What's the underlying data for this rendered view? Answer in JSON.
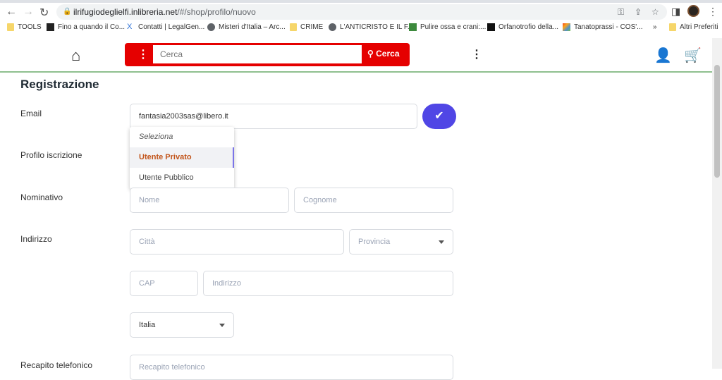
{
  "browser": {
    "url_host": "ilrifugiodeglielfi.inlibreria.net",
    "url_path": "/#/shop/profilo/nuovo",
    "bookmarks": [
      {
        "label": "TOOLS",
        "icon": "folder-icon"
      },
      {
        "label": "Fino a quando il Co...",
        "icon": "site-icon"
      },
      {
        "label": "Contatti | LegalGen...",
        "icon": "dna-icon"
      },
      {
        "label": "Misteri d'Italia – Arc...",
        "icon": "globe-icon"
      },
      {
        "label": "CRIME",
        "icon": "folder-icon"
      },
      {
        "label": "L'ANTICRISTO E IL F...",
        "icon": "globe-icon"
      },
      {
        "label": "Pulire ossa e crani:...",
        "icon": "site-icon"
      },
      {
        "label": "Orfanotrofio della...",
        "icon": "site-icon"
      },
      {
        "label": "Tanatoprassi - COS'...",
        "icon": "joomla-icon"
      }
    ],
    "more": "»",
    "other_bookmarks": "Altri Preferiti"
  },
  "header": {
    "search_placeholder": "Cerca",
    "search_button": "Cerca"
  },
  "form": {
    "title": "Registrazione",
    "email_label": "Email",
    "email_value": "fantasia2003sas@libero.it",
    "profile_label": "Profilo iscrizione",
    "profile_options": [
      "Seleziona",
      "Utente Privato",
      "Utente Pubblico"
    ],
    "profile_highlighted": "Utente Privato",
    "name_label": "Nominativo",
    "name_placeholder": "Nome",
    "surname_placeholder": "Cognome",
    "address_label": "Indirizzo",
    "city_placeholder": "Città",
    "province_placeholder": "Provincia",
    "cap_placeholder": "CAP",
    "street_placeholder": "Indirizzo",
    "country_value": "Italia",
    "phone_label": "Recapito telefonico",
    "phone_placeholder": "Recapito telefonico"
  },
  "colors": {
    "search_bar": "#e50000",
    "verify_button": "#5046e5",
    "highlight_option": "#c2551b"
  }
}
